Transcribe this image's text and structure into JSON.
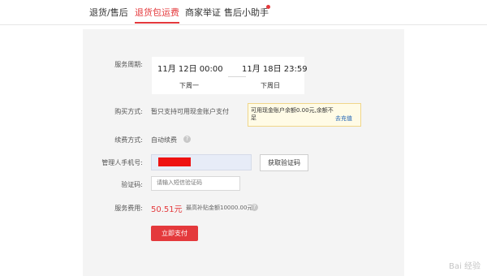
{
  "tabs": [
    {
      "label": "退货/售后"
    },
    {
      "label": "退货包运费"
    },
    {
      "label": "商家举证"
    },
    {
      "label": "售后小助手"
    }
  ],
  "form": {
    "period": {
      "label": "服务周期:",
      "start": "11月 12日 00:00",
      "end": "11月 18日 23:59",
      "start_sub": "下周一",
      "end_sub": "下周日"
    },
    "payment": {
      "label": "购买方式:",
      "value": "暂只支持可用现金账户支付",
      "tip_text": "可用现金账户余额0.00元,余额不足",
      "tip_link": "去充值"
    },
    "renew": {
      "label": "续费方式:",
      "value": "自动续费"
    },
    "phone": {
      "label": "管理人手机号:",
      "button": "获取验证码"
    },
    "code": {
      "label": "验证码:",
      "placeholder": "请输入短信验证码"
    },
    "fee": {
      "label": "服务费用:",
      "value": "50.51元",
      "note": "最高补贴金额10000.00元"
    },
    "submit": "立即支付"
  },
  "watermark": "Bai 经验",
  "colors": {
    "accent": "#e4393c",
    "link": "#1a5fb4"
  },
  "icons": {
    "help": "question-circle-icon"
  }
}
